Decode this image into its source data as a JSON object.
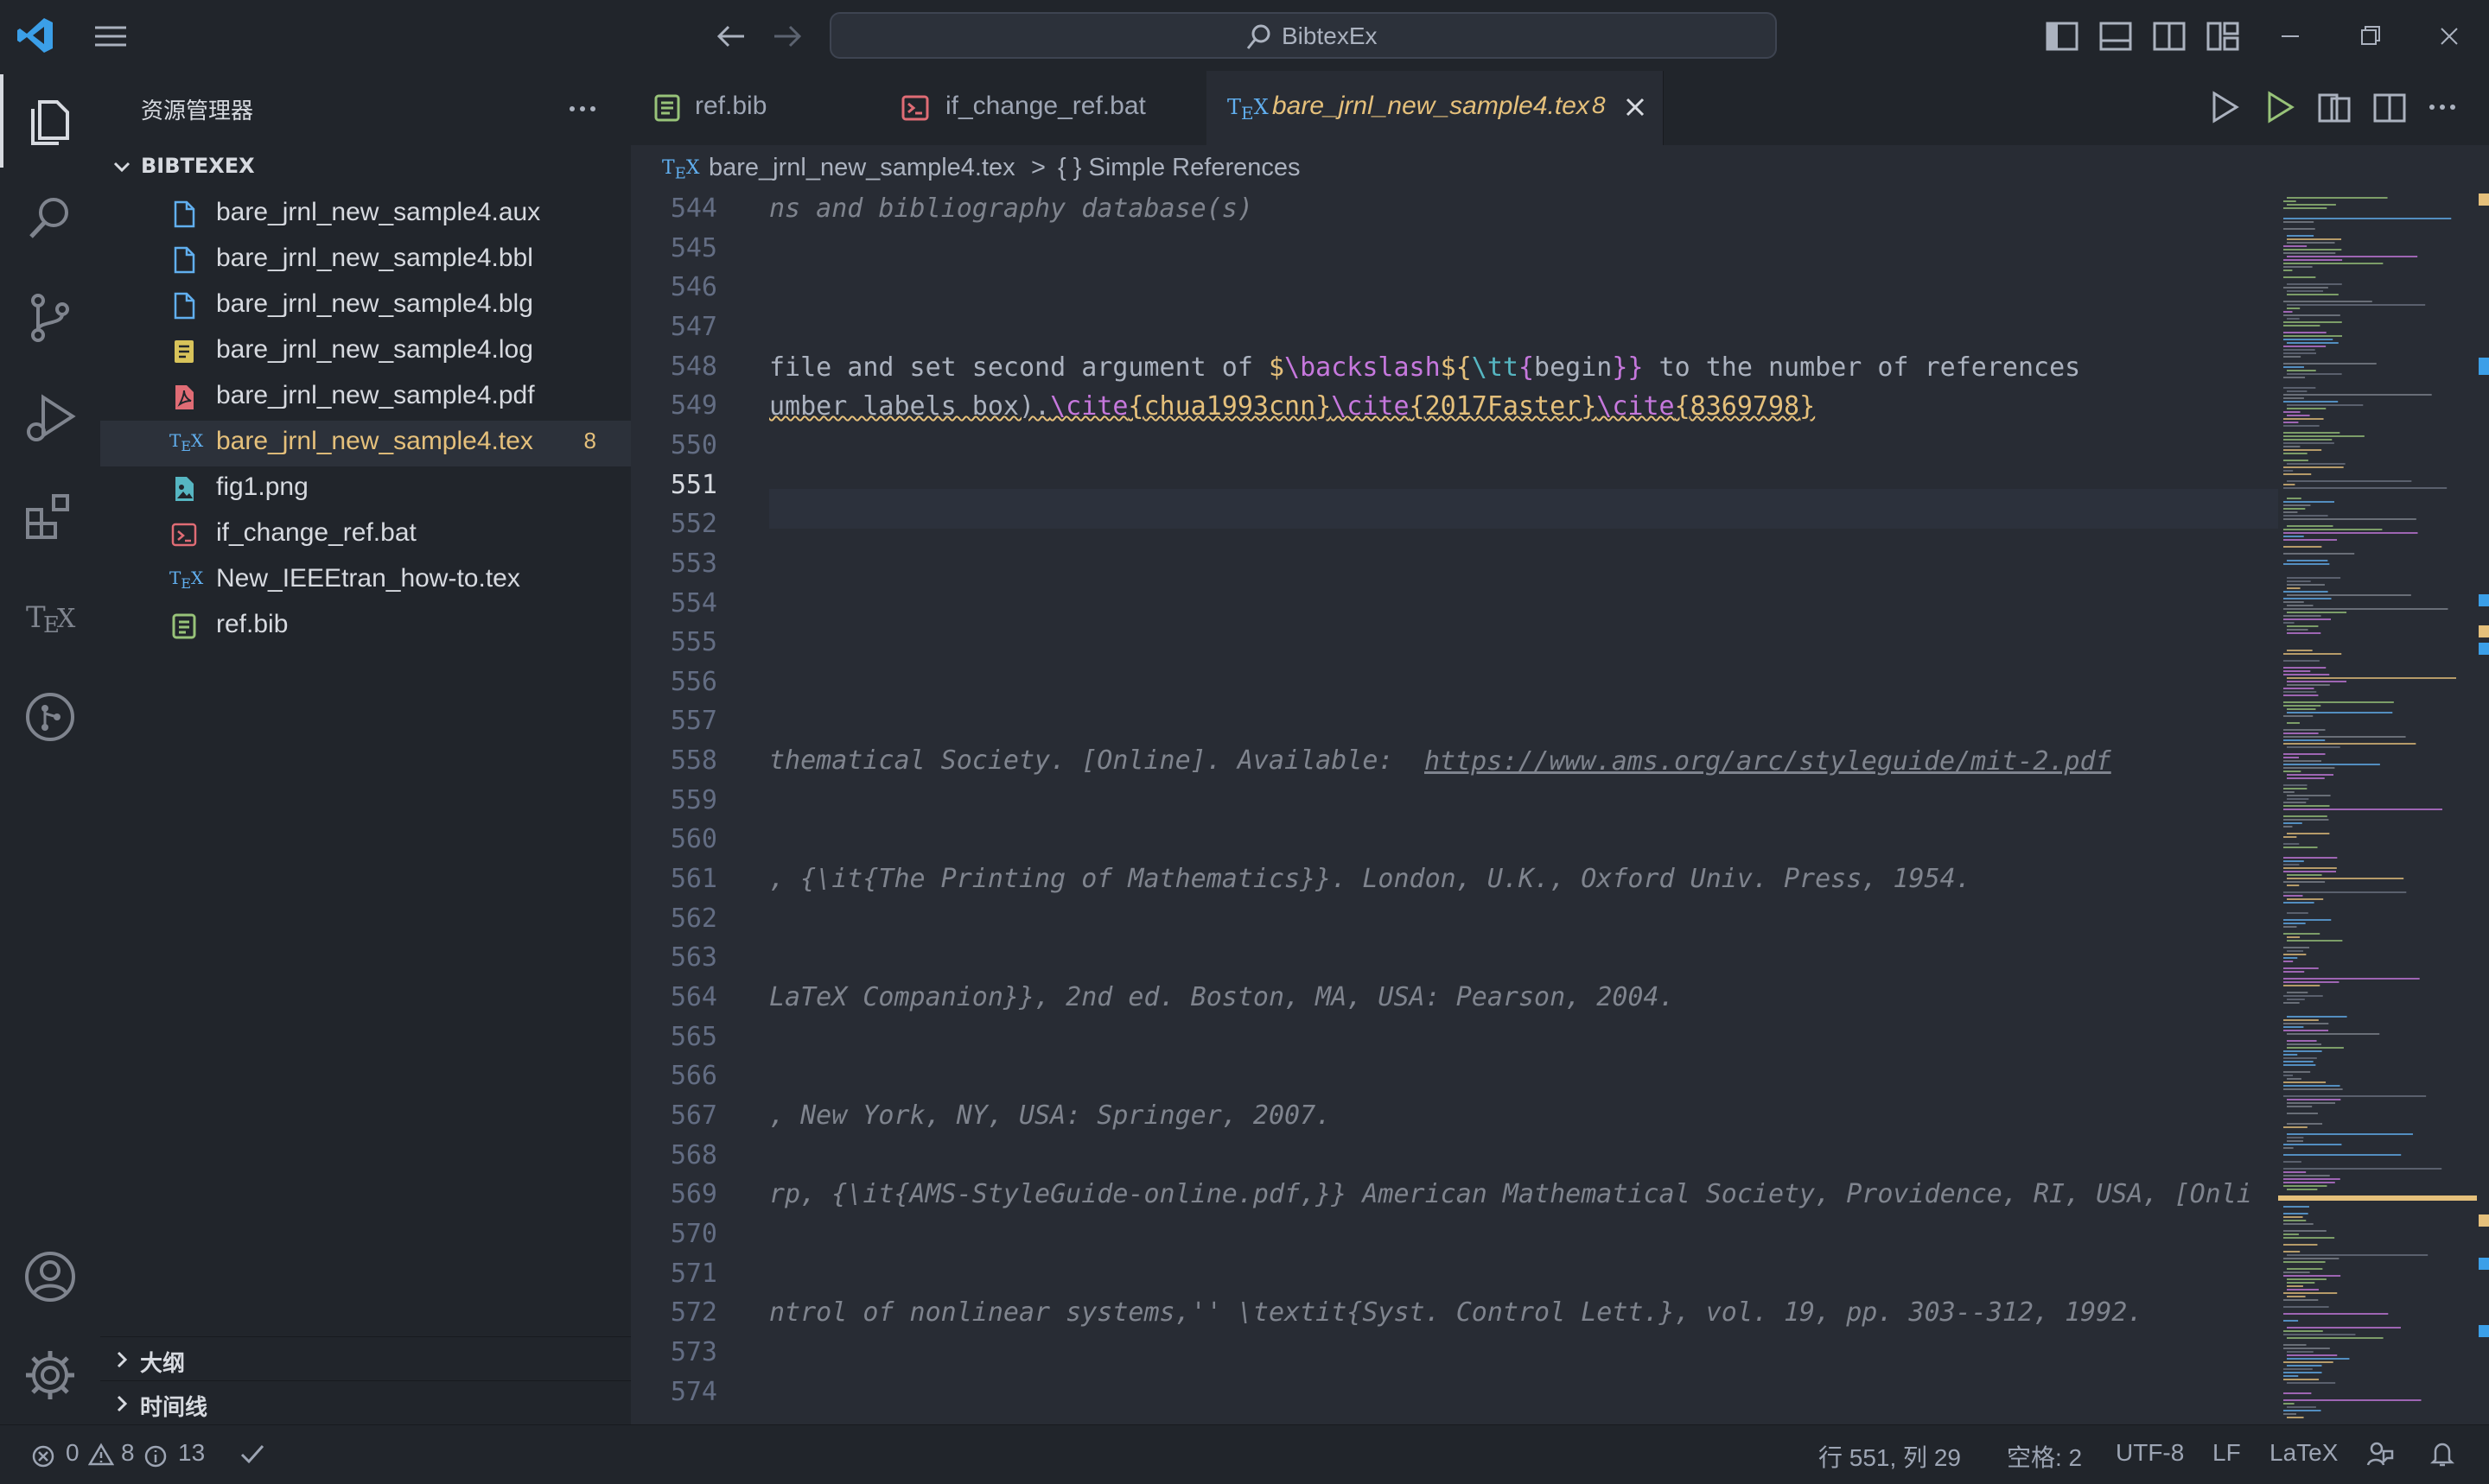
{
  "window": {
    "search_text": "BibtexEx"
  },
  "colors": {
    "accent": "#e5c07b",
    "bg": "#282c34",
    "chrome": "#21252b",
    "tex_icon": "#61afef",
    "error": "#e06c75",
    "green": "#98c379",
    "purple": "#c678dd",
    "cyan": "#56b6c2"
  },
  "sidebar": {
    "title": "资源管理器",
    "folder": "BIBTEXEX",
    "files": [
      {
        "name": "bare_jrnl_new_sample4.aux",
        "icon": "file-icon"
      },
      {
        "name": "bare_jrnl_new_sample4.bbl",
        "icon": "file-icon"
      },
      {
        "name": "bare_jrnl_new_sample4.blg",
        "icon": "file-icon"
      },
      {
        "name": "bare_jrnl_new_sample4.log",
        "icon": "log-icon"
      },
      {
        "name": "bare_jrnl_new_sample4.pdf",
        "icon": "pdf-icon"
      },
      {
        "name": "bare_jrnl_new_sample4.tex",
        "icon": "tex-icon",
        "badge": "8",
        "active": true
      },
      {
        "name": "fig1.png",
        "icon": "image-icon"
      },
      {
        "name": "if_change_ref.bat",
        "icon": "terminal-icon"
      },
      {
        "name": "New_IEEEtran_how-to.tex",
        "icon": "tex-icon"
      },
      {
        "name": "ref.bib",
        "icon": "bib-icon"
      }
    ],
    "outline": "大纲",
    "timeline": "时间线"
  },
  "tabs": [
    {
      "label": "ref.bib"
    },
    {
      "label": "if_change_ref.bat"
    },
    {
      "label": "bare_jrnl_new_sample4.tex",
      "badge": "8",
      "active": true
    }
  ],
  "breadcrumb": {
    "file": "bare_jrnl_new_sample4.tex",
    "separator": ">",
    "symbol": "{ } Simple References"
  },
  "editor": {
    "current_line": "551",
    "lines": [
      {
        "n": "544",
        "text": "ns and bibliography database(s)"
      },
      {
        "n": "545",
        "text": ""
      },
      {
        "n": "546",
        "text": ""
      },
      {
        "n": "547",
        "text": ""
      },
      {
        "n": "548",
        "text": ""
      },
      {
        "n": "549",
        "text": ""
      },
      {
        "n": "550",
        "text": ""
      },
      {
        "n": "551",
        "text": ""
      },
      {
        "n": "552",
        "text": ""
      },
      {
        "n": "553",
        "text": ""
      },
      {
        "n": "554",
        "text": ""
      },
      {
        "n": "555",
        "text": ""
      },
      {
        "n": "556",
        "text": ""
      },
      {
        "n": "557",
        "text": ""
      },
      {
        "n": "558",
        "text": "thematical Society. [Online]. Available: "
      },
      {
        "n": "559",
        "text": ""
      },
      {
        "n": "560",
        "text": ""
      },
      {
        "n": "561",
        "text": ", {\\it{The Printing of Mathematics}}. London, U.K., Oxford Univ. Press, 1954."
      },
      {
        "n": "562",
        "text": ""
      },
      {
        "n": "563",
        "text": ""
      },
      {
        "n": "564",
        "text": "LaTeX Companion}}, 2nd ed. Boston, MA, USA: Pearson, 2004."
      },
      {
        "n": "565",
        "text": ""
      },
      {
        "n": "566",
        "text": ""
      },
      {
        "n": "567",
        "text": ", New York, NY, USA: Springer, 2007."
      },
      {
        "n": "568",
        "text": ""
      },
      {
        "n": "569",
        "text": "rp, {\\it{AMS-StyleGuide-online.pdf,}} American Mathematical Society, Providence, RI, USA, [Onli"
      },
      {
        "n": "570",
        "text": ""
      },
      {
        "n": "571",
        "text": ""
      },
      {
        "n": "572",
        "text": "ntrol of nonlinear systems,'' \\textit{Syst. Control Lett.}, vol. 19, pp. 303--312, 1992."
      },
      {
        "n": "573",
        "text": ""
      },
      {
        "n": "574",
        "text": ""
      }
    ],
    "line548": {
      "a": " file and set second argument of ",
      "b": "$",
      "c": "\\backslash",
      "d": "$",
      "e": "{",
      "f": "\\tt",
      "g": "{",
      "h": "begin",
      "i": "}}",
      "j": " to the number of references"
    },
    "line549": {
      "a": "umber labels box).",
      "b": "\\cite",
      "c": "{",
      "d": "chua1993cnn",
      "e": "}",
      "f": "\\cite",
      "g": "{",
      "h": "2017Faster",
      "i": "}",
      "j": "\\cite",
      "k": "{",
      "l": "8369798",
      "m": "}"
    },
    "url558": "https://www.ams.org/arc/styleguide/mit-2.pdf"
  },
  "statusbar": {
    "errors": "0",
    "warnings": "8",
    "infos": "13",
    "position": "行 551, 列 29",
    "indent": "空格: 2",
    "encoding": "UTF-8",
    "eol": "LF",
    "language": "LaTeX"
  }
}
